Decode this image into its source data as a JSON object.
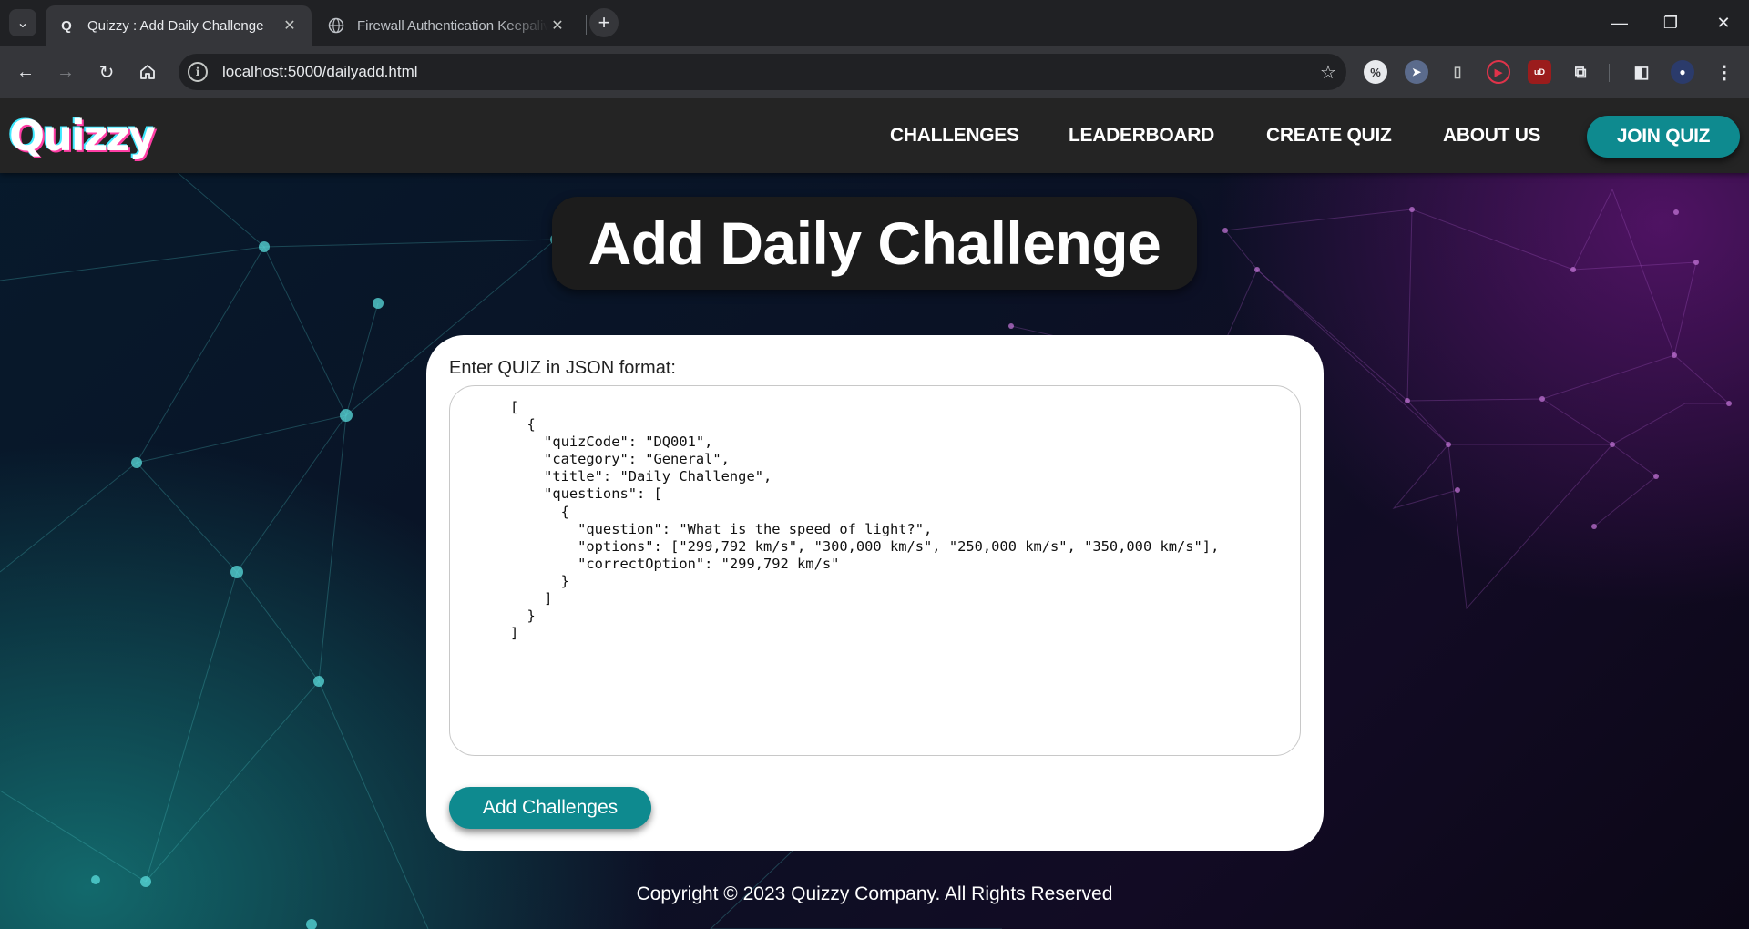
{
  "browser": {
    "tabs": [
      {
        "title": "Quizzy : Add Daily Challenge",
        "favicon": "Q",
        "active": true
      },
      {
        "title": "Firewall Authentication Keepalive",
        "favicon": "globe-icon",
        "active": false
      }
    ],
    "tab_close": "✕",
    "new_tab": "+",
    "url": "localhost:5000/dailyadd.html",
    "window_controls": {
      "minimize": "—",
      "restore": "❐",
      "close": "✕"
    }
  },
  "site": {
    "logo": "Quizzy",
    "nav": [
      "CHALLENGES",
      "LEADERBOARD",
      "CREATE QUIZ",
      "ABOUT US"
    ],
    "join_button": "JOIN QUIZ",
    "accent_color": "#0e8a8f"
  },
  "main": {
    "heading": "Add Daily Challenge",
    "input_label": "Enter QUIZ in JSON format:",
    "json_text": "[\n  {\n    \"quizCode\": \"DQ001\",\n    \"category\": \"General\",\n    \"title\": \"Daily Challenge\",\n    \"questions\": [\n      {\n        \"question\": \"What is the speed of light?\",\n        \"options\": [\"299,792 km/s\", \"300,000 km/s\", \"250,000 km/s\", \"350,000 km/s\"],\n        \"correctOption\": \"299,792 km/s\"\n      }\n    ]\n  }\n]",
    "submit_button": "Add Challenges"
  },
  "footer": {
    "copyright": "Copyright © 2023 Quizzy Company. All Rights Reserved"
  }
}
